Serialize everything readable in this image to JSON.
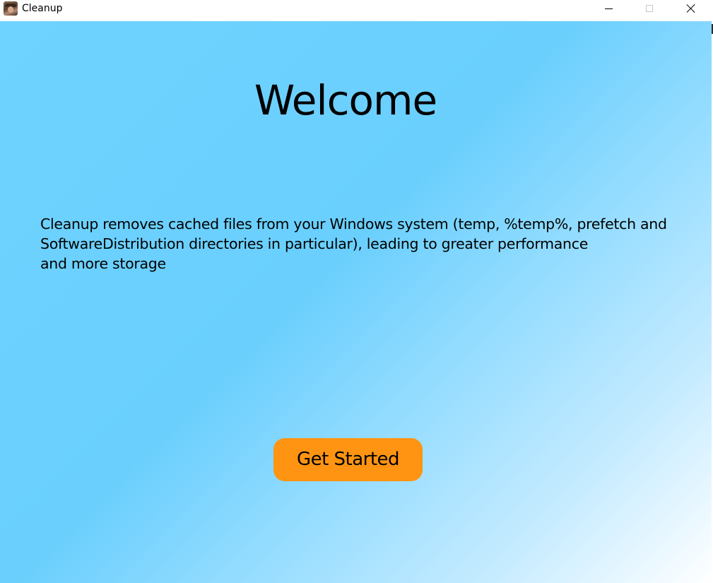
{
  "window": {
    "title": "Cleanup",
    "icon": "app-avatar-icon",
    "controls": {
      "minimize": "minimize-icon",
      "maximize": "maximize-icon",
      "close": "close-icon"
    }
  },
  "main": {
    "heading": "Welcome",
    "description_lines": [
      "Cleanup removes cached files from your Windows system (temp, %temp%, prefetch and",
      "SoftwareDistribution directories in particular), leading to greater performance",
      "and more storage"
    ],
    "button_label": "Get Started"
  },
  "colors": {
    "background_start": "#6fd3ff",
    "background_end": "#ffffff",
    "button": "#ff9412",
    "text": "#000000"
  }
}
